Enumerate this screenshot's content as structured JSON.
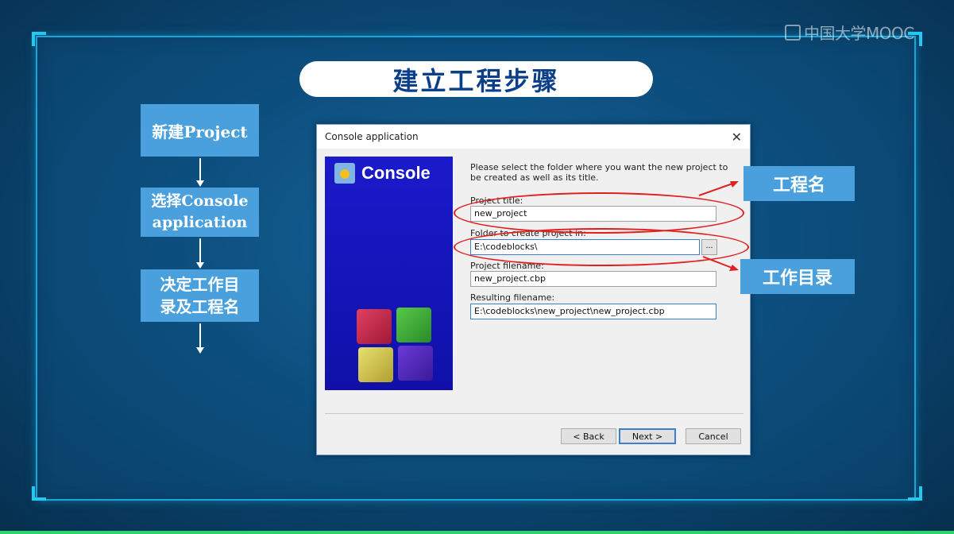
{
  "watermark": {
    "text": "中国大学MOOC"
  },
  "slide": {
    "title": "建立工程步骤",
    "steps": [
      {
        "label": "新建Project"
      },
      {
        "label": "选择Console application"
      },
      {
        "label": "决定工作目录及工程名"
      }
    ],
    "callouts": {
      "project_name": "工程名",
      "work_directory": "工作目录"
    }
  },
  "dialog": {
    "title": "Console application",
    "close_glyph": "✕",
    "wizard_banner": "Console",
    "intro": "Please select the folder where you want the new project to be created as well as its title.",
    "fields": {
      "project_title": {
        "label": "Project title:",
        "value": "new_project"
      },
      "folder": {
        "label": "Folder to create project in:",
        "value": "E:\\codeblocks\\",
        "browse": "..."
      },
      "project_filename": {
        "label": "Project filename:",
        "value": "new_project.cbp"
      },
      "resulting_filename": {
        "label": "Resulting filename:",
        "value": "E:\\codeblocks\\new_project\\new_project.cbp"
      }
    },
    "buttons": {
      "back": "< Back",
      "next": "Next >",
      "cancel": "Cancel"
    }
  },
  "colors": {
    "accent_blue": "#4aa0dc",
    "title_text": "#0b3f8a",
    "annotation_red": "#e02020",
    "frame_cyan": "#18a6d8"
  }
}
